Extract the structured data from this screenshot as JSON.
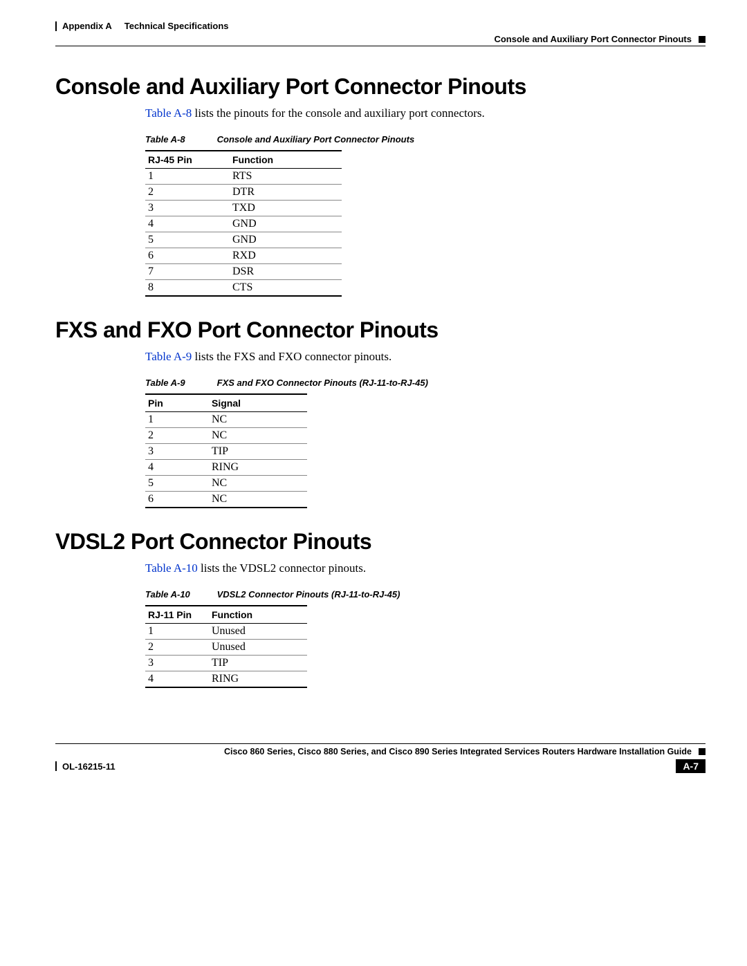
{
  "header": {
    "appendix": "Appendix A",
    "chapter_title": "Technical Specifications",
    "section_label": "Console and Auxiliary Port Connector Pinouts"
  },
  "sections": [
    {
      "title": "Console and Auxiliary Port Connector Pinouts",
      "intro_ref": "Table A-8",
      "intro_rest": " lists the pinouts for the console and auxiliary port connectors.",
      "caption_num": "Table A-8",
      "caption_title": "Console and Auxiliary Port Connector Pinouts",
      "headers": [
        "RJ-45 Pin",
        "Function"
      ],
      "rows": [
        [
          "1",
          "RTS"
        ],
        [
          "2",
          "DTR"
        ],
        [
          "3",
          "TXD"
        ],
        [
          "4",
          "GND"
        ],
        [
          "5",
          "GND"
        ],
        [
          "6",
          "RXD"
        ],
        [
          "7",
          "DSR"
        ],
        [
          "8",
          "CTS"
        ]
      ]
    },
    {
      "title": "FXS and FXO Port Connector Pinouts",
      "intro_ref": "Table A-9",
      "intro_rest": " lists the FXS and FXO connector pinouts.",
      "caption_num": "Table A-9",
      "caption_title": "FXS and FXO Connector Pinouts (RJ-11-to-RJ-45)",
      "headers": [
        "Pin",
        "Signal"
      ],
      "rows": [
        [
          "1",
          "NC"
        ],
        [
          "2",
          "NC"
        ],
        [
          "3",
          "TIP"
        ],
        [
          "4",
          "RING"
        ],
        [
          "5",
          "NC"
        ],
        [
          "6",
          "NC"
        ]
      ]
    },
    {
      "title": "VDSL2 Port Connector Pinouts",
      "intro_ref": "Table A-10",
      "intro_rest": " lists the VDSL2 connector pinouts.",
      "caption_num": "Table A-10",
      "caption_title": "VDSL2 Connector Pinouts (RJ-11-to-RJ-45)",
      "headers": [
        "RJ-11 Pin",
        "Function"
      ],
      "rows": [
        [
          "1",
          "Unused"
        ],
        [
          "2",
          "Unused"
        ],
        [
          "3",
          "TIP"
        ],
        [
          "4",
          "RING"
        ]
      ]
    }
  ],
  "footer": {
    "guide_title": "Cisco 860 Series, Cisco 880 Series, and Cisco 890 Series Integrated Services Routers Hardware Installation Guide",
    "doc_number": "OL-16215-11",
    "page_number": "A-7"
  }
}
